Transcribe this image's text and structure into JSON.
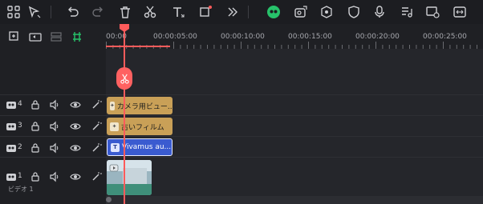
{
  "toolbar": {
    "icons": [
      "grid-icon",
      "select-icon",
      "undo-icon",
      "redo-icon",
      "delete-icon",
      "cut-icon",
      "text-icon",
      "crop-icon",
      "more-icon",
      "ai-icon",
      "sticker-icon",
      "record-icon",
      "shield-icon",
      "mic-icon",
      "music-list-icon",
      "screen-add-icon",
      "fit-icon"
    ]
  },
  "subbar": {
    "icons": [
      "add-track-icon",
      "group-icon",
      "layers-icon",
      "link-icon"
    ]
  },
  "ruler": {
    "ticks": [
      "00:00",
      "00:00:05:00",
      "00:00:10:00",
      "00:00:15:00",
      "00:00:20:00",
      "00:00:25:00"
    ]
  },
  "tracks": [
    {
      "num": "4",
      "clip_label": "カメラ用ビュー..."
    },
    {
      "num": "3",
      "clip_label": "古いフィルム"
    },
    {
      "num": "2",
      "clip_label": "Vivamus au..."
    },
    {
      "num": "1",
      "clip_label": ""
    }
  ],
  "video_track_label": "ビデオ 1",
  "colors": {
    "accent": "#ff5b5b",
    "effect_clip": "#c9a057",
    "text_clip": "#3a5bd0",
    "ai_green": "#27c26a"
  }
}
